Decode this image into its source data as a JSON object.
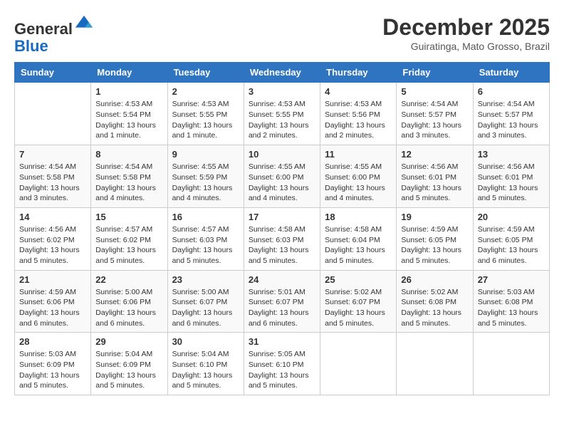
{
  "header": {
    "logo_general": "General",
    "logo_blue": "Blue",
    "month_title": "December 2025",
    "location": "Guiratinga, Mato Grosso, Brazil"
  },
  "weekdays": [
    "Sunday",
    "Monday",
    "Tuesday",
    "Wednesday",
    "Thursday",
    "Friday",
    "Saturday"
  ],
  "weeks": [
    [
      {
        "day": "",
        "info": ""
      },
      {
        "day": "1",
        "info": "Sunrise: 4:53 AM\nSunset: 5:54 PM\nDaylight: 13 hours\nand 1 minute."
      },
      {
        "day": "2",
        "info": "Sunrise: 4:53 AM\nSunset: 5:55 PM\nDaylight: 13 hours\nand 1 minute."
      },
      {
        "day": "3",
        "info": "Sunrise: 4:53 AM\nSunset: 5:55 PM\nDaylight: 13 hours\nand 2 minutes."
      },
      {
        "day": "4",
        "info": "Sunrise: 4:53 AM\nSunset: 5:56 PM\nDaylight: 13 hours\nand 2 minutes."
      },
      {
        "day": "5",
        "info": "Sunrise: 4:54 AM\nSunset: 5:57 PM\nDaylight: 13 hours\nand 3 minutes."
      },
      {
        "day": "6",
        "info": "Sunrise: 4:54 AM\nSunset: 5:57 PM\nDaylight: 13 hours\nand 3 minutes."
      }
    ],
    [
      {
        "day": "7",
        "info": "Sunrise: 4:54 AM\nSunset: 5:58 PM\nDaylight: 13 hours\nand 3 minutes."
      },
      {
        "day": "8",
        "info": "Sunrise: 4:54 AM\nSunset: 5:58 PM\nDaylight: 13 hours\nand 4 minutes."
      },
      {
        "day": "9",
        "info": "Sunrise: 4:55 AM\nSunset: 5:59 PM\nDaylight: 13 hours\nand 4 minutes."
      },
      {
        "day": "10",
        "info": "Sunrise: 4:55 AM\nSunset: 6:00 PM\nDaylight: 13 hours\nand 4 minutes."
      },
      {
        "day": "11",
        "info": "Sunrise: 4:55 AM\nSunset: 6:00 PM\nDaylight: 13 hours\nand 4 minutes."
      },
      {
        "day": "12",
        "info": "Sunrise: 4:56 AM\nSunset: 6:01 PM\nDaylight: 13 hours\nand 5 minutes."
      },
      {
        "day": "13",
        "info": "Sunrise: 4:56 AM\nSunset: 6:01 PM\nDaylight: 13 hours\nand 5 minutes."
      }
    ],
    [
      {
        "day": "14",
        "info": "Sunrise: 4:56 AM\nSunset: 6:02 PM\nDaylight: 13 hours\nand 5 minutes."
      },
      {
        "day": "15",
        "info": "Sunrise: 4:57 AM\nSunset: 6:02 PM\nDaylight: 13 hours\nand 5 minutes."
      },
      {
        "day": "16",
        "info": "Sunrise: 4:57 AM\nSunset: 6:03 PM\nDaylight: 13 hours\nand 5 minutes."
      },
      {
        "day": "17",
        "info": "Sunrise: 4:58 AM\nSunset: 6:03 PM\nDaylight: 13 hours\nand 5 minutes."
      },
      {
        "day": "18",
        "info": "Sunrise: 4:58 AM\nSunset: 6:04 PM\nDaylight: 13 hours\nand 5 minutes."
      },
      {
        "day": "19",
        "info": "Sunrise: 4:59 AM\nSunset: 6:05 PM\nDaylight: 13 hours\nand 5 minutes."
      },
      {
        "day": "20",
        "info": "Sunrise: 4:59 AM\nSunset: 6:05 PM\nDaylight: 13 hours\nand 6 minutes."
      }
    ],
    [
      {
        "day": "21",
        "info": "Sunrise: 4:59 AM\nSunset: 6:06 PM\nDaylight: 13 hours\nand 6 minutes."
      },
      {
        "day": "22",
        "info": "Sunrise: 5:00 AM\nSunset: 6:06 PM\nDaylight: 13 hours\nand 6 minutes."
      },
      {
        "day": "23",
        "info": "Sunrise: 5:00 AM\nSunset: 6:07 PM\nDaylight: 13 hours\nand 6 minutes."
      },
      {
        "day": "24",
        "info": "Sunrise: 5:01 AM\nSunset: 6:07 PM\nDaylight: 13 hours\nand 6 minutes."
      },
      {
        "day": "25",
        "info": "Sunrise: 5:02 AM\nSunset: 6:07 PM\nDaylight: 13 hours\nand 5 minutes."
      },
      {
        "day": "26",
        "info": "Sunrise: 5:02 AM\nSunset: 6:08 PM\nDaylight: 13 hours\nand 5 minutes."
      },
      {
        "day": "27",
        "info": "Sunrise: 5:03 AM\nSunset: 6:08 PM\nDaylight: 13 hours\nand 5 minutes."
      }
    ],
    [
      {
        "day": "28",
        "info": "Sunrise: 5:03 AM\nSunset: 6:09 PM\nDaylight: 13 hours\nand 5 minutes."
      },
      {
        "day": "29",
        "info": "Sunrise: 5:04 AM\nSunset: 6:09 PM\nDaylight: 13 hours\nand 5 minutes."
      },
      {
        "day": "30",
        "info": "Sunrise: 5:04 AM\nSunset: 6:10 PM\nDaylight: 13 hours\nand 5 minutes."
      },
      {
        "day": "31",
        "info": "Sunrise: 5:05 AM\nSunset: 6:10 PM\nDaylight: 13 hours\nand 5 minutes."
      },
      {
        "day": "",
        "info": ""
      },
      {
        "day": "",
        "info": ""
      },
      {
        "day": "",
        "info": ""
      }
    ]
  ]
}
